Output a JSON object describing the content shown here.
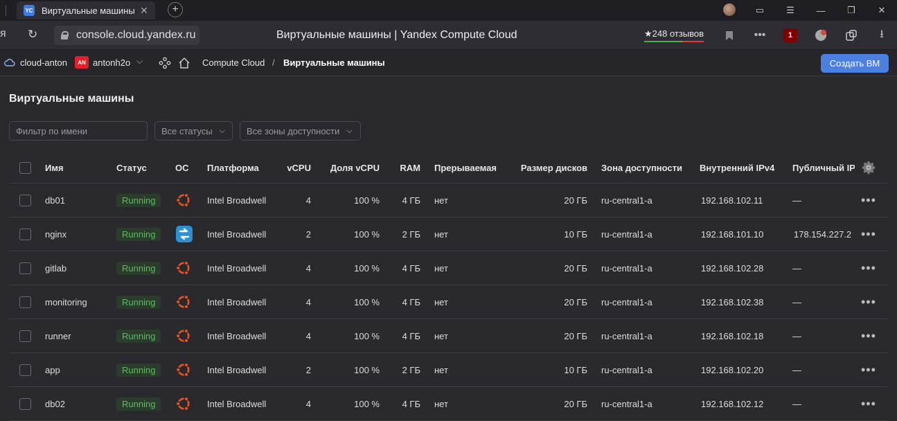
{
  "browser": {
    "tab_title": "Виртуальные машины",
    "tab_favicon": "YC",
    "url": "console.cloud.yandex.ru",
    "page_title": "Виртуальные машины | Yandex Compute Cloud",
    "reviews": "★248 отзывов",
    "ublock_badge": "1"
  },
  "header": {
    "cloud": "cloud-anton",
    "folder_badge": "AN",
    "folder": "antonh2o",
    "breadcrumb_service": "Compute Cloud",
    "breadcrumb_sep": "/",
    "breadcrumb_page": "Виртуальные машины",
    "create_button": "Создать ВМ"
  },
  "main": {
    "title": "Виртуальные машины",
    "filter_placeholder": "Фильтр по имени",
    "status_select": "Все статусы",
    "zone_select": "Все зоны доступности"
  },
  "table": {
    "columns": [
      "Имя",
      "Статус",
      "ОС",
      "Платформа",
      "vCPU",
      "Доля vCPU",
      "RAM",
      "Прерываемая",
      "Размер дисков",
      "Зона доступности",
      "Внутренний IPv4",
      "Публичный IP"
    ],
    "rows": [
      {
        "name": "db01",
        "status": "Running",
        "os": "ubuntu",
        "platform": "Intel Broadwell",
        "vcpu": "4",
        "share": "100 %",
        "ram": "4 ГБ",
        "preemptible": "нет",
        "disk": "20 ГБ",
        "zone": "ru-central1-a",
        "ipv4": "192.168.102.11",
        "public_ip": "—"
      },
      {
        "name": "nginx",
        "status": "Running",
        "os": "debian",
        "platform": "Intel Broadwell",
        "vcpu": "2",
        "share": "100 %",
        "ram": "2 ГБ",
        "preemptible": "нет",
        "disk": "10 ГБ",
        "zone": "ru-central1-a",
        "ipv4": "192.168.101.10",
        "public_ip": "178.154.227.2"
      },
      {
        "name": "gitlab",
        "status": "Running",
        "os": "ubuntu",
        "platform": "Intel Broadwell",
        "vcpu": "4",
        "share": "100 %",
        "ram": "4 ГБ",
        "preemptible": "нет",
        "disk": "20 ГБ",
        "zone": "ru-central1-a",
        "ipv4": "192.168.102.28",
        "public_ip": "—"
      },
      {
        "name": "monitoring",
        "status": "Running",
        "os": "ubuntu",
        "platform": "Intel Broadwell",
        "vcpu": "4",
        "share": "100 %",
        "ram": "4 ГБ",
        "preemptible": "нет",
        "disk": "20 ГБ",
        "zone": "ru-central1-a",
        "ipv4": "192.168.102.38",
        "public_ip": "—"
      },
      {
        "name": "runner",
        "status": "Running",
        "os": "ubuntu",
        "platform": "Intel Broadwell",
        "vcpu": "4",
        "share": "100 %",
        "ram": "4 ГБ",
        "preemptible": "нет",
        "disk": "20 ГБ",
        "zone": "ru-central1-a",
        "ipv4": "192.168.102.18",
        "public_ip": "—"
      },
      {
        "name": "app",
        "status": "Running",
        "os": "ubuntu",
        "platform": "Intel Broadwell",
        "vcpu": "2",
        "share": "100 %",
        "ram": "2 ГБ",
        "preemptible": "нет",
        "disk": "10 ГБ",
        "zone": "ru-central1-a",
        "ipv4": "192.168.102.20",
        "public_ip": "—"
      },
      {
        "name": "db02",
        "status": "Running",
        "os": "ubuntu",
        "platform": "Intel Broadwell",
        "vcpu": "4",
        "share": "100 %",
        "ram": "4 ГБ",
        "preemptible": "нет",
        "disk": "20 ГБ",
        "zone": "ru-central1-a",
        "ipv4": "192.168.102.12",
        "public_ip": "—"
      }
    ]
  },
  "colors": {
    "accent": "#4d7fe0",
    "running": "#5dbb63",
    "ubuntu": "#e95420",
    "debian_icon": "#2d8fd5"
  }
}
